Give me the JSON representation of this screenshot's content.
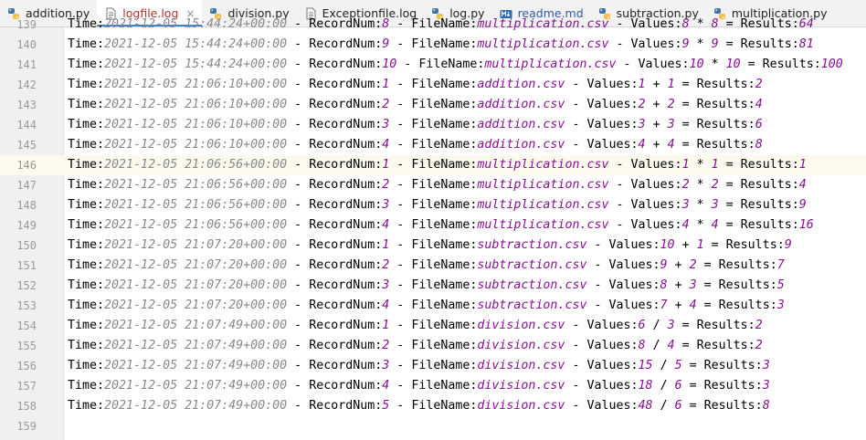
{
  "tabs": [
    {
      "label": "addition.py",
      "icon": "python-file-icon",
      "active": false,
      "closable": false
    },
    {
      "label": "logfile.log",
      "icon": "log-file-icon",
      "active": true,
      "closable": true
    },
    {
      "label": "division.py",
      "icon": "python-file-icon",
      "active": false,
      "closable": false
    },
    {
      "label": "Exceptionfile.log",
      "icon": "log-file-icon",
      "active": false,
      "closable": false
    },
    {
      "label": "log.py",
      "icon": "python-file-icon",
      "active": false,
      "closable": false
    },
    {
      "label": "readme.md",
      "icon": "markdown-file-icon",
      "active": false,
      "closable": false
    },
    {
      "label": "subtraction.py",
      "icon": "python-file-icon",
      "active": false,
      "closable": false
    },
    {
      "label": "multiplication.py",
      "icon": "python-file-icon",
      "active": false,
      "closable": false
    }
  ],
  "close_glyph": "×",
  "editor": {
    "current_line": 146,
    "lines": [
      {
        "n": "139",
        "ts": "2021-12-05 15:44:24+00:00",
        "rec": "8",
        "file": "multiplication.csv",
        "a": "8",
        "op": "*",
        "b": "8",
        "res": "64"
      },
      {
        "n": "140",
        "ts": "2021-12-05 15:44:24+00:00",
        "rec": "9",
        "file": "multiplication.csv",
        "a": "9",
        "op": "*",
        "b": "9",
        "res": "81"
      },
      {
        "n": "141",
        "ts": "2021-12-05 15:44:24+00:00",
        "rec": "10",
        "file": "multiplication.csv",
        "a": "10",
        "op": "*",
        "b": "10",
        "res": "100"
      },
      {
        "n": "142",
        "ts": "2021-12-05 21:06:10+00:00",
        "rec": "1",
        "file": "addition.csv",
        "a": "1",
        "op": "+",
        "b": "1",
        "res": "2"
      },
      {
        "n": "143",
        "ts": "2021-12-05 21:06:10+00:00",
        "rec": "2",
        "file": "addition.csv",
        "a": "2",
        "op": "+",
        "b": "2",
        "res": "4"
      },
      {
        "n": "144",
        "ts": "2021-12-05 21:06:10+00:00",
        "rec": "3",
        "file": "addition.csv",
        "a": "3",
        "op": "+",
        "b": "3",
        "res": "6"
      },
      {
        "n": "145",
        "ts": "2021-12-05 21:06:10+00:00",
        "rec": "4",
        "file": "addition.csv",
        "a": "4",
        "op": "+",
        "b": "4",
        "res": "8"
      },
      {
        "n": "146",
        "ts": "2021-12-05 21:06:56+00:00",
        "rec": "1",
        "file": "multiplication.csv",
        "a": "1",
        "op": "*",
        "b": "1",
        "res": "1"
      },
      {
        "n": "147",
        "ts": "2021-12-05 21:06:56+00:00",
        "rec": "2",
        "file": "multiplication.csv",
        "a": "2",
        "op": "*",
        "b": "2",
        "res": "4"
      },
      {
        "n": "148",
        "ts": "2021-12-05 21:06:56+00:00",
        "rec": "3",
        "file": "multiplication.csv",
        "a": "3",
        "op": "*",
        "b": "3",
        "res": "9"
      },
      {
        "n": "149",
        "ts": "2021-12-05 21:06:56+00:00",
        "rec": "4",
        "file": "multiplication.csv",
        "a": "4",
        "op": "*",
        "b": "4",
        "res": "16"
      },
      {
        "n": "150",
        "ts": "2021-12-05 21:07:20+00:00",
        "rec": "1",
        "file": "subtraction.csv",
        "a": "10",
        "op": "+",
        "b": "1",
        "res": "9"
      },
      {
        "n": "151",
        "ts": "2021-12-05 21:07:20+00:00",
        "rec": "2",
        "file": "subtraction.csv",
        "a": "9",
        "op": "+",
        "b": "2",
        "res": "7"
      },
      {
        "n": "152",
        "ts": "2021-12-05 21:07:20+00:00",
        "rec": "3",
        "file": "subtraction.csv",
        "a": "8",
        "op": "+",
        "b": "3",
        "res": "5"
      },
      {
        "n": "153",
        "ts": "2021-12-05 21:07:20+00:00",
        "rec": "4",
        "file": "subtraction.csv",
        "a": "7",
        "op": "+",
        "b": "4",
        "res": "3"
      },
      {
        "n": "154",
        "ts": "2021-12-05 21:07:49+00:00",
        "rec": "1",
        "file": "division.csv",
        "a": "6",
        "op": "/",
        "b": "3",
        "res": "2"
      },
      {
        "n": "155",
        "ts": "2021-12-05 21:07:49+00:00",
        "rec": "2",
        "file": "division.csv",
        "a": "8",
        "op": "/",
        "b": "4",
        "res": "2"
      },
      {
        "n": "156",
        "ts": "2021-12-05 21:07:49+00:00",
        "rec": "3",
        "file": "division.csv",
        "a": "15",
        "op": "/",
        "b": "5",
        "res": "3"
      },
      {
        "n": "157",
        "ts": "2021-12-05 21:07:49+00:00",
        "rec": "4",
        "file": "division.csv",
        "a": "18",
        "op": "/",
        "b": "6",
        "res": "3"
      },
      {
        "n": "158",
        "ts": "2021-12-05 21:07:49+00:00",
        "rec": "5",
        "file": "division.csv",
        "a": "48",
        "op": "/",
        "b": "6",
        "res": "8"
      },
      {
        "n": "159",
        "empty": true
      }
    ]
  },
  "labels": {
    "time": "Time:",
    "sep": " - ",
    "record": "RecordNum:",
    "file": "FileName:",
    "values": "Values:",
    "results": "Results:"
  },
  "colors": {
    "accent": "#4083c9",
    "timestamp": "#8a8a8a",
    "value": "#871094",
    "current_line": "#fcfaed"
  }
}
